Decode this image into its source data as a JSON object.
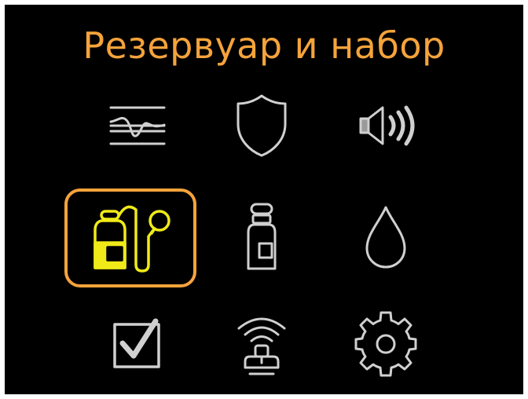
{
  "screen": {
    "title": "Резервуар и набор"
  },
  "colors": {
    "background": "#000000",
    "accent": "#f5a33b",
    "icon": "#d0d0d0",
    "selected_icon": "#f0ea18"
  },
  "menu": {
    "selected": "reservoir-and-set",
    "items": [
      {
        "id": "history",
        "icon": "history-graph-icon"
      },
      {
        "id": "alerts",
        "icon": "shield-icon"
      },
      {
        "id": "sound",
        "icon": "speaker-icon"
      },
      {
        "id": "reservoir-and-set",
        "icon": "reservoir-set-icon"
      },
      {
        "id": "insulin",
        "icon": "vial-icon"
      },
      {
        "id": "basal",
        "icon": "drop-icon"
      },
      {
        "id": "status",
        "icon": "checkbox-icon"
      },
      {
        "id": "sensor",
        "icon": "sensor-icon"
      },
      {
        "id": "settings",
        "icon": "gear-icon"
      }
    ]
  }
}
